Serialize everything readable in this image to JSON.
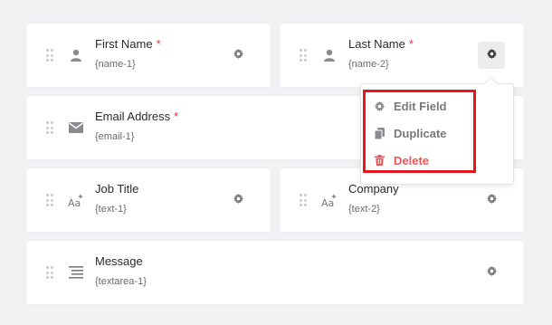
{
  "fields": [
    {
      "label": "First Name",
      "required": "*",
      "tag": "{name-1}",
      "icon": "person-icon"
    },
    {
      "label": "Last Name",
      "required": "*",
      "tag": "{name-2}",
      "icon": "person-icon"
    },
    {
      "label": "Email Address",
      "required": "*",
      "tag": "{email-1}",
      "icon": "envelope-icon"
    },
    {
      "label": "Job Title",
      "tag": "{text-1}",
      "icon": "text-sparkle-icon"
    },
    {
      "label": "Company",
      "tag": "{text-2}",
      "icon": "text-sparkle-icon"
    },
    {
      "label": "Message",
      "tag": "{textarea-1}",
      "icon": "textarea-lines-icon"
    }
  ],
  "context_menu": {
    "items": [
      {
        "label": "Edit Field",
        "icon": "gear-icon"
      },
      {
        "label": "Duplicate",
        "icon": "copy-icon"
      },
      {
        "label": "Delete",
        "icon": "trash-icon"
      }
    ]
  },
  "colors": {
    "background": "#f1f1f3",
    "required": "#e0383e",
    "delete": "#ee5557",
    "highlight": "#e31720"
  }
}
